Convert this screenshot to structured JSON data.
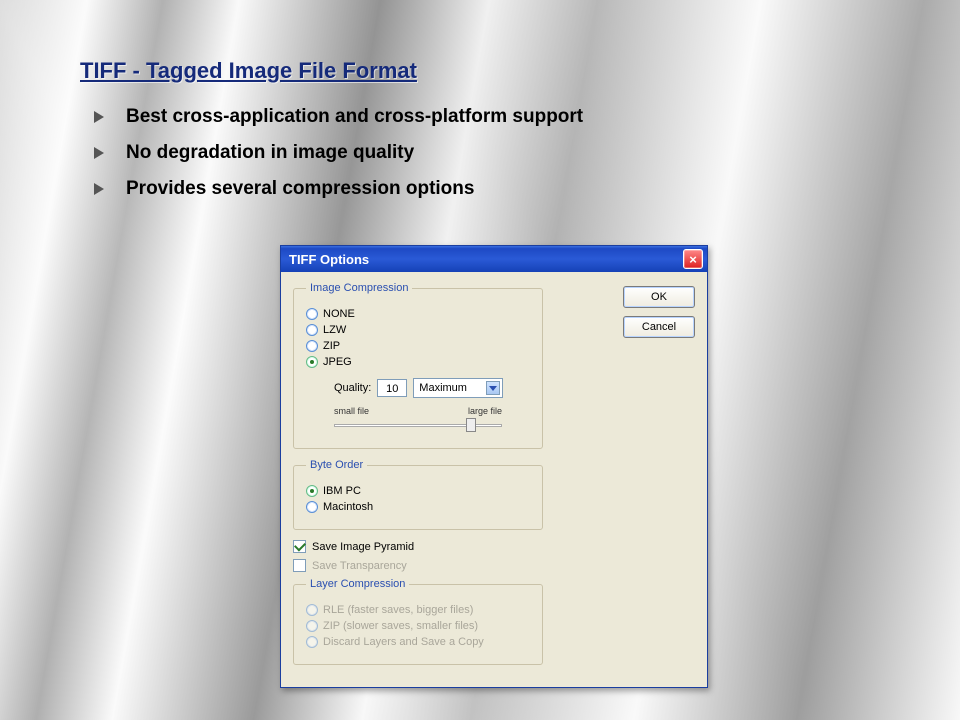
{
  "slide": {
    "title": "TIFF -  Tagged Image File Format",
    "bullets": [
      "Best cross-application and cross-platform support",
      "No degradation in image quality",
      "Provides several compression options"
    ]
  },
  "dialog": {
    "title": "TIFF Options",
    "buttons": {
      "ok": "OK",
      "cancel": "Cancel"
    },
    "image_compression": {
      "legend": "Image Compression",
      "options": [
        "NONE",
        "LZW",
        "ZIP",
        "JPEG"
      ],
      "selected": "JPEG",
      "quality_label": "Quality:",
      "quality_value": "10",
      "quality_preset": "Maximum",
      "slider_min_label": "small file",
      "slider_max_label": "large file"
    },
    "byte_order": {
      "legend": "Byte Order",
      "options": [
        "IBM PC",
        "Macintosh"
      ],
      "selected": "IBM PC"
    },
    "checkboxes": {
      "save_pyramid": {
        "label": "Save Image Pyramid",
        "checked": true
      },
      "save_transparency": {
        "label": "Save Transparency",
        "checked": false,
        "disabled": true
      }
    },
    "layer_compression": {
      "legend": "Layer Compression",
      "options": [
        "RLE (faster saves, bigger files)",
        "ZIP (slower saves, smaller files)",
        "Discard Layers and Save a Copy"
      ]
    }
  }
}
